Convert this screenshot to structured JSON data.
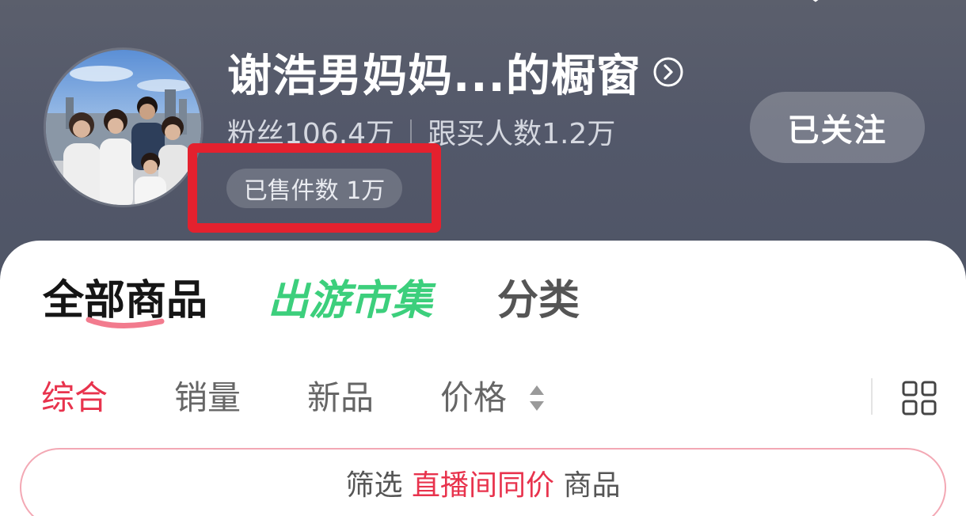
{
  "header": {
    "shop_title": "谢浩男妈妈...的橱窗",
    "fans_label": "粉丝106.4万",
    "buyers_label": "跟买人数1.2万",
    "follow_button": "已关注",
    "sold_badge": "已售件数 1万"
  },
  "tabs": {
    "all": "全部商品",
    "market": "出游市集",
    "category": "分类"
  },
  "sort": {
    "zonghe": "综合",
    "xiaoliang": "销量",
    "xinpin": "新品",
    "price": "价格"
  },
  "filter": {
    "prefix": "筛选",
    "highlight": "直播间同价",
    "suffix": "商品"
  },
  "colors": {
    "accent_red": "#e8334d",
    "market_green": "#3ccf7c",
    "annotation_red": "#e4212e"
  },
  "icons": [
    "circle-chevron-right-icon",
    "sort-arrows-icon",
    "grid-view-icon"
  ]
}
